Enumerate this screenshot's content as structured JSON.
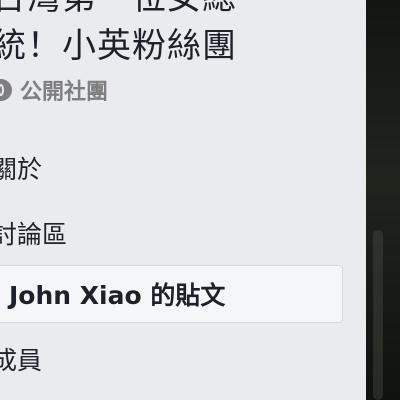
{
  "group": {
    "title_line1": "台灣第一位女總",
    "title_line2": "統！小英粉絲團",
    "privacy": "公開社團",
    "privacy_icon": "globe-icon"
  },
  "nav": {
    "about": "關於",
    "discussion": "討論區",
    "posts": "John Xiao 的貼文",
    "members": "成員"
  },
  "colors": {
    "background": "#e9ebee",
    "selected_background": "#f5f6f7",
    "muted_text": "#7f7f7f",
    "text": "#1d2129",
    "right_panel": "#121512"
  }
}
